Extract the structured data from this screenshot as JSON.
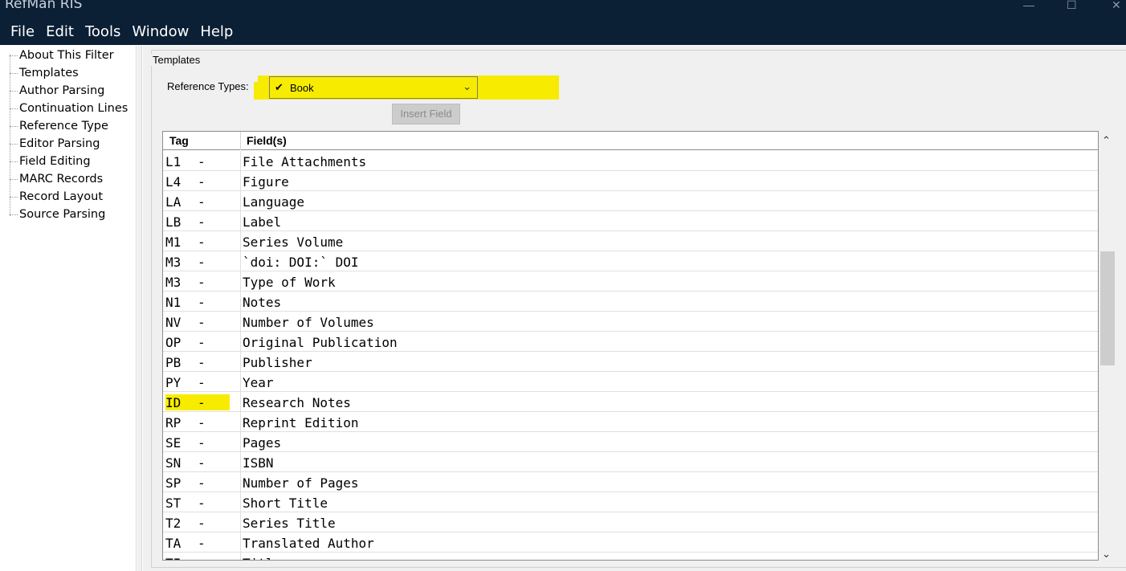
{
  "window": {
    "title": "RefMan RIS",
    "minimize_icon": "minimize-icon",
    "maximize_icon": "maximize-icon",
    "close_icon": "close-icon"
  },
  "menu": [
    "File",
    "Edit",
    "Tools",
    "Window",
    "Help"
  ],
  "sidebar": {
    "items": [
      {
        "label": "About This Filter"
      },
      {
        "label": "Templates"
      },
      {
        "label": "Author Parsing"
      },
      {
        "label": "Continuation Lines"
      },
      {
        "label": "Reference Type"
      },
      {
        "label": "Editor Parsing"
      },
      {
        "label": "Field Editing"
      },
      {
        "label": "MARC Records"
      },
      {
        "label": "Record Layout"
      },
      {
        "label": "Source Parsing"
      }
    ],
    "selected": "Templates"
  },
  "templates": {
    "group_title": "Templates",
    "reference_types_label": "Reference Types:",
    "reference_type_value": "Book",
    "reference_type_check": "✔",
    "insert_field_label": "Insert Field",
    "highlight_color": "#f7ec00",
    "columns": {
      "tag": "Tag",
      "fields": "Field(s)"
    },
    "rows": [
      {
        "tag": "L1",
        "dash": "-",
        "field": "File Attachments"
      },
      {
        "tag": "L4",
        "dash": "-",
        "field": "Figure"
      },
      {
        "tag": "LA",
        "dash": "-",
        "field": "Language"
      },
      {
        "tag": "LB",
        "dash": "-",
        "field": "Label"
      },
      {
        "tag": "M1",
        "dash": "-",
        "field": "Series Volume"
      },
      {
        "tag": "M3",
        "dash": "-",
        "field": "`doi: DOI:` DOI"
      },
      {
        "tag": "M3",
        "dash": "-",
        "field": "Type of Work"
      },
      {
        "tag": "N1",
        "dash": "-",
        "field": "Notes"
      },
      {
        "tag": "NV",
        "dash": "-",
        "field": "Number of Volumes"
      },
      {
        "tag": "OP",
        "dash": "-",
        "field": "Original Publication"
      },
      {
        "tag": "PB",
        "dash": "-",
        "field": "Publisher"
      },
      {
        "tag": "PY",
        "dash": "-",
        "field": "Year"
      },
      {
        "tag": "ID",
        "dash": "-",
        "field": "Research Notes",
        "highlighted": true
      },
      {
        "tag": "RP",
        "dash": "-",
        "field": "Reprint Edition"
      },
      {
        "tag": "SE",
        "dash": "-",
        "field": "Pages"
      },
      {
        "tag": "SN",
        "dash": "-",
        "field": "ISBN"
      },
      {
        "tag": "SP",
        "dash": "-",
        "field": "Number of Pages"
      },
      {
        "tag": "ST",
        "dash": "-",
        "field": "Short Title"
      },
      {
        "tag": "T2",
        "dash": "-",
        "field": "Series Title"
      },
      {
        "tag": "TA",
        "dash": "-",
        "field": "Translated Author"
      },
      {
        "tag": "TI",
        "dash": "-",
        "field": "Title"
      }
    ]
  }
}
